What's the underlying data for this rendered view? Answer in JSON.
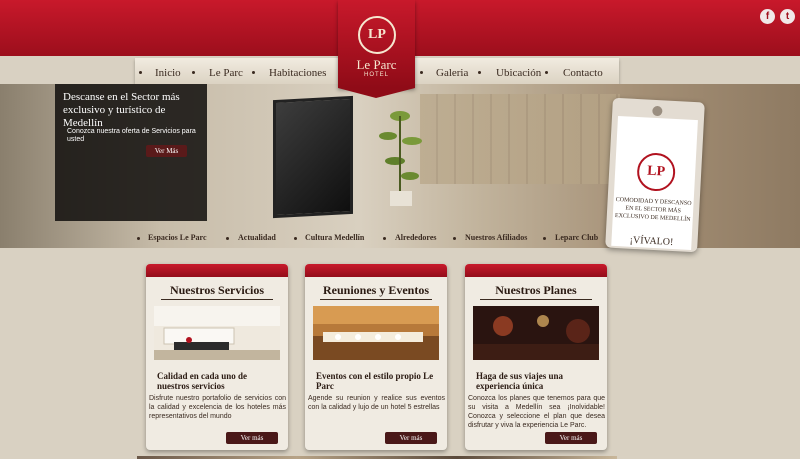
{
  "brand": {
    "logo_initials": "LP",
    "name": "Le Parc",
    "subtitle": "HOTEL"
  },
  "social": {
    "facebook_glyph": "f",
    "twitter_glyph": "t"
  },
  "nav": {
    "items": [
      "Inicio",
      "Le Parc",
      "Habitaciones",
      "Galeria",
      "Ubicación",
      "Contacto"
    ]
  },
  "hero": {
    "title": "Descanse en el Sector más exclusivo y turístico de Medellín",
    "text": "Conozca nuestra oferta de Servicios para usted",
    "button": "Ver Más"
  },
  "tag": {
    "logo_initials": "LP",
    "text": "COMODIDAD Y DESCANSO EN EL SECTOR MÁS EXCLUSIVO DE MEDELLÍN",
    "cta": "¡VÍVALO!"
  },
  "subnav": {
    "items": [
      "Espacios Le Parc",
      "Actualidad",
      "Cultura Medellín",
      "Alrededores",
      "Nuestros Afiliados",
      "Leparc Club"
    ]
  },
  "cards": [
    {
      "title": "Nuestros Servicios",
      "subtitle": "Calidad en cada uno de nuestros servicios",
      "text": "Disfrute nuestro portafolio de servicios con la calidad y excelencia de los hoteles más representativos del mundo",
      "button": "Ver más"
    },
    {
      "title": "Reuniones y Eventos",
      "subtitle": "Eventos con el estilo propio Le Parc",
      "text": "Agende su reunion y realice sus eventos con la calidad y lujo de un hotel 5 estrellas",
      "button": "Ver más"
    },
    {
      "title": "Nuestros Planes",
      "subtitle": "Haga de sus viajes una experiencia única",
      "text": "Conozca los planes que tenemos para que su visita a Medellín sea ¡Inolvidable! Conozca y seleccione el plan que desea disfrutar y viva la experiencia Le Parc.",
      "button": "Ver más"
    }
  ],
  "colors": {
    "brand_red": "#b1121f",
    "button_brown": "#4a1818",
    "background": "#d9d1c2"
  }
}
